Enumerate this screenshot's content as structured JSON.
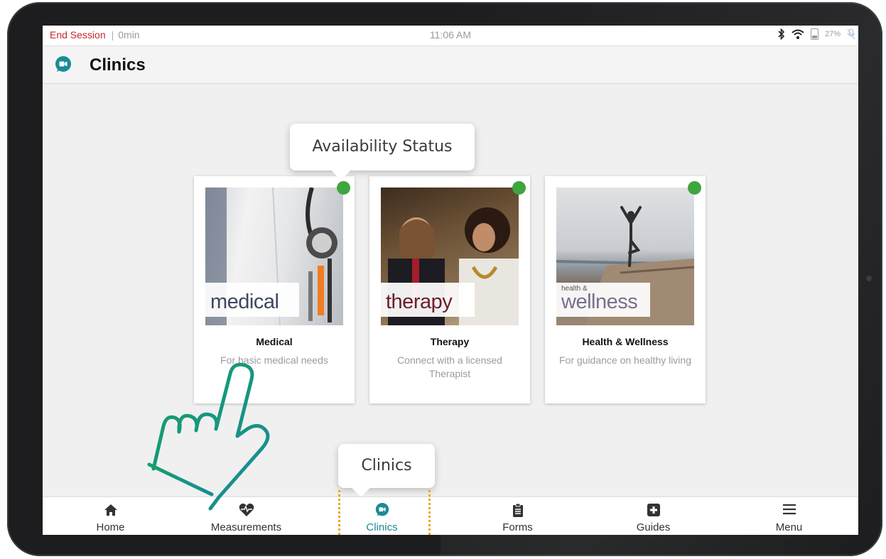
{
  "status_bar": {
    "end_session": "End Session",
    "separator": "|",
    "duration": "0min",
    "time": "11:06 AM",
    "battery": "27%",
    "icons": [
      "bluetooth-icon",
      "wifi-icon",
      "battery-icon",
      "mic-off-icon"
    ]
  },
  "page": {
    "title": "Clinics",
    "title_icon": "video-chat-icon"
  },
  "clinics": [
    {
      "photo_label": "medical",
      "photo_label_small": "",
      "title": "Medical",
      "description": "For basic medical needs",
      "available": true
    },
    {
      "photo_label": "therapy",
      "photo_label_small": "",
      "title": "Therapy",
      "description": "Connect with a licensed Therapist",
      "available": true
    },
    {
      "photo_label": "wellness",
      "photo_label_small": "health &",
      "title": "Health & Wellness",
      "description": "For guidance on healthy living",
      "available": true
    }
  ],
  "tooltips": {
    "availability": "Availability Status",
    "clinics": "Clinics"
  },
  "nav": [
    {
      "label": "Home",
      "icon": "home-icon"
    },
    {
      "label": "Measurements",
      "icon": "heart-pulse-icon"
    },
    {
      "label": "Clinics",
      "icon": "video-chat-icon",
      "active": true
    },
    {
      "label": "Forms",
      "icon": "clipboard-icon"
    },
    {
      "label": "Guides",
      "icon": "first-aid-icon"
    },
    {
      "label": "Menu",
      "icon": "hamburger-menu-icon"
    }
  ],
  "colors": {
    "accent": "#1a8b97",
    "end_session": "#c62828",
    "available": "#3ea63e",
    "highlight": "#f2a516",
    "hand_gradient": [
      "#14a06a",
      "#1a8b97"
    ]
  }
}
